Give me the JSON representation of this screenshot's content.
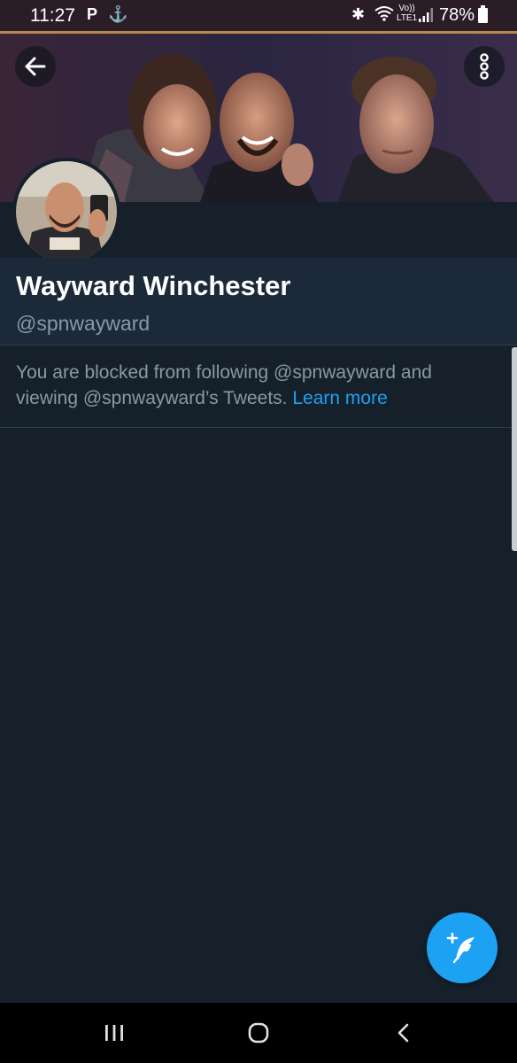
{
  "status_bar": {
    "time": "11:27",
    "notification_p": "P",
    "lte_top": "Vo))",
    "lte_bottom": "LTE1",
    "battery": "78%"
  },
  "profile": {
    "display_name": "Wayward Winchester",
    "handle": "@spnwayward"
  },
  "blocked_notice": {
    "text": "You are blocked from following @spnwayward and viewing @spnwayward’s Tweets.",
    "link_label": "Learn more"
  },
  "colors": {
    "background": "#15202b",
    "name_section": "#1c2938",
    "accent": "#1da1f2",
    "secondary_text": "#8899a6"
  },
  "icons": {
    "back": "arrow-left-icon",
    "more": "more-vertical-icon",
    "compose": "compose-tweet-icon",
    "nav_recent": "recent-apps-icon",
    "nav_home": "home-icon",
    "nav_back": "chevron-left-icon"
  }
}
